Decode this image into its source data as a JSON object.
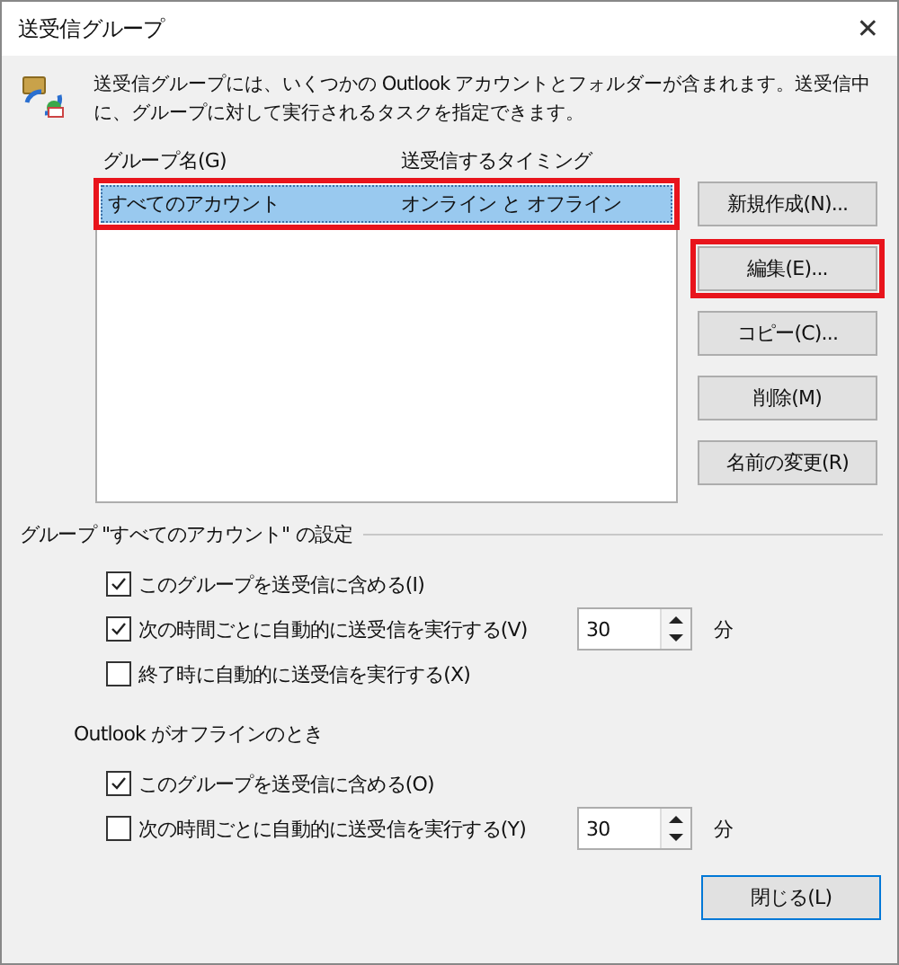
{
  "window": {
    "title": "送受信グループ",
    "close": "✕"
  },
  "description": "送受信グループには、いくつかの Outlook アカウントとフォルダーが含まれます。送受信中に、グループに対して実行されるタスクを指定できます。",
  "list": {
    "columns": [
      "グループ名(G)",
      "送受信するタイミング"
    ],
    "rows": [
      {
        "name": "すべてのアカウント",
        "timing": "オンライン と オフライン",
        "selected": true,
        "highlighted": true
      }
    ]
  },
  "side_buttons": [
    {
      "label": "新規作成(N)...",
      "highlighted": false
    },
    {
      "label": "編集(E)...",
      "highlighted": true
    },
    {
      "label": "コピー(C)...",
      "highlighted": false
    },
    {
      "label": "削除(M)",
      "highlighted": false
    },
    {
      "label": "名前の変更(R)",
      "highlighted": false
    }
  ],
  "settings": {
    "title": "グループ \"すべてのアカウント\" の設定",
    "options": [
      {
        "kind": "checkbox",
        "label": "このグループを送受信に含める(I)",
        "checked": true
      },
      {
        "kind": "spinner",
        "label": "次の時間ごとに自動的に送受信を実行する(V)",
        "checked": true,
        "value": "30",
        "unit": "分"
      },
      {
        "kind": "checkbox",
        "label": "終了時に自動的に送受信を実行する(X)",
        "checked": false
      }
    ]
  },
  "offline": {
    "title": "Outlook がオフラインのとき",
    "options": [
      {
        "kind": "checkbox",
        "label": "このグループを送受信に含める(O)",
        "checked": true
      },
      {
        "kind": "spinner",
        "label": "次の時間ごとに自動的に送受信を実行する(Y)",
        "checked": false,
        "value": "30",
        "unit": "分"
      }
    ]
  },
  "close_button": "閉じる(L)"
}
